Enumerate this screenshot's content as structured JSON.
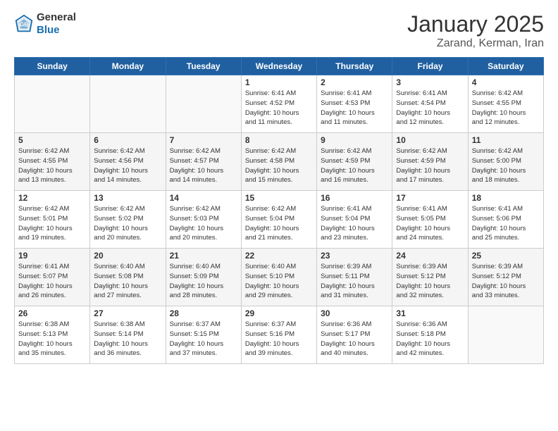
{
  "header": {
    "logo_general": "General",
    "logo_blue": "Blue",
    "month": "January 2025",
    "location": "Zarand, Kerman, Iran"
  },
  "weekdays": [
    "Sunday",
    "Monday",
    "Tuesday",
    "Wednesday",
    "Thursday",
    "Friday",
    "Saturday"
  ],
  "weeks": [
    [
      {
        "day": "",
        "info": ""
      },
      {
        "day": "",
        "info": ""
      },
      {
        "day": "",
        "info": ""
      },
      {
        "day": "1",
        "info": "Sunrise: 6:41 AM\nSunset: 4:52 PM\nDaylight: 10 hours\nand 11 minutes."
      },
      {
        "day": "2",
        "info": "Sunrise: 6:41 AM\nSunset: 4:53 PM\nDaylight: 10 hours\nand 11 minutes."
      },
      {
        "day": "3",
        "info": "Sunrise: 6:41 AM\nSunset: 4:54 PM\nDaylight: 10 hours\nand 12 minutes."
      },
      {
        "day": "4",
        "info": "Sunrise: 6:42 AM\nSunset: 4:55 PM\nDaylight: 10 hours\nand 12 minutes."
      }
    ],
    [
      {
        "day": "5",
        "info": "Sunrise: 6:42 AM\nSunset: 4:55 PM\nDaylight: 10 hours\nand 13 minutes."
      },
      {
        "day": "6",
        "info": "Sunrise: 6:42 AM\nSunset: 4:56 PM\nDaylight: 10 hours\nand 14 minutes."
      },
      {
        "day": "7",
        "info": "Sunrise: 6:42 AM\nSunset: 4:57 PM\nDaylight: 10 hours\nand 14 minutes."
      },
      {
        "day": "8",
        "info": "Sunrise: 6:42 AM\nSunset: 4:58 PM\nDaylight: 10 hours\nand 15 minutes."
      },
      {
        "day": "9",
        "info": "Sunrise: 6:42 AM\nSunset: 4:59 PM\nDaylight: 10 hours\nand 16 minutes."
      },
      {
        "day": "10",
        "info": "Sunrise: 6:42 AM\nSunset: 4:59 PM\nDaylight: 10 hours\nand 17 minutes."
      },
      {
        "day": "11",
        "info": "Sunrise: 6:42 AM\nSunset: 5:00 PM\nDaylight: 10 hours\nand 18 minutes."
      }
    ],
    [
      {
        "day": "12",
        "info": "Sunrise: 6:42 AM\nSunset: 5:01 PM\nDaylight: 10 hours\nand 19 minutes."
      },
      {
        "day": "13",
        "info": "Sunrise: 6:42 AM\nSunset: 5:02 PM\nDaylight: 10 hours\nand 20 minutes."
      },
      {
        "day": "14",
        "info": "Sunrise: 6:42 AM\nSunset: 5:03 PM\nDaylight: 10 hours\nand 20 minutes."
      },
      {
        "day": "15",
        "info": "Sunrise: 6:42 AM\nSunset: 5:04 PM\nDaylight: 10 hours\nand 21 minutes."
      },
      {
        "day": "16",
        "info": "Sunrise: 6:41 AM\nSunset: 5:04 PM\nDaylight: 10 hours\nand 23 minutes."
      },
      {
        "day": "17",
        "info": "Sunrise: 6:41 AM\nSunset: 5:05 PM\nDaylight: 10 hours\nand 24 minutes."
      },
      {
        "day": "18",
        "info": "Sunrise: 6:41 AM\nSunset: 5:06 PM\nDaylight: 10 hours\nand 25 minutes."
      }
    ],
    [
      {
        "day": "19",
        "info": "Sunrise: 6:41 AM\nSunset: 5:07 PM\nDaylight: 10 hours\nand 26 minutes."
      },
      {
        "day": "20",
        "info": "Sunrise: 6:40 AM\nSunset: 5:08 PM\nDaylight: 10 hours\nand 27 minutes."
      },
      {
        "day": "21",
        "info": "Sunrise: 6:40 AM\nSunset: 5:09 PM\nDaylight: 10 hours\nand 28 minutes."
      },
      {
        "day": "22",
        "info": "Sunrise: 6:40 AM\nSunset: 5:10 PM\nDaylight: 10 hours\nand 29 minutes."
      },
      {
        "day": "23",
        "info": "Sunrise: 6:39 AM\nSunset: 5:11 PM\nDaylight: 10 hours\nand 31 minutes."
      },
      {
        "day": "24",
        "info": "Sunrise: 6:39 AM\nSunset: 5:12 PM\nDaylight: 10 hours\nand 32 minutes."
      },
      {
        "day": "25",
        "info": "Sunrise: 6:39 AM\nSunset: 5:12 PM\nDaylight: 10 hours\nand 33 minutes."
      }
    ],
    [
      {
        "day": "26",
        "info": "Sunrise: 6:38 AM\nSunset: 5:13 PM\nDaylight: 10 hours\nand 35 minutes."
      },
      {
        "day": "27",
        "info": "Sunrise: 6:38 AM\nSunset: 5:14 PM\nDaylight: 10 hours\nand 36 minutes."
      },
      {
        "day": "28",
        "info": "Sunrise: 6:37 AM\nSunset: 5:15 PM\nDaylight: 10 hours\nand 37 minutes."
      },
      {
        "day": "29",
        "info": "Sunrise: 6:37 AM\nSunset: 5:16 PM\nDaylight: 10 hours\nand 39 minutes."
      },
      {
        "day": "30",
        "info": "Sunrise: 6:36 AM\nSunset: 5:17 PM\nDaylight: 10 hours\nand 40 minutes."
      },
      {
        "day": "31",
        "info": "Sunrise: 6:36 AM\nSunset: 5:18 PM\nDaylight: 10 hours\nand 42 minutes."
      },
      {
        "day": "",
        "info": ""
      }
    ]
  ]
}
